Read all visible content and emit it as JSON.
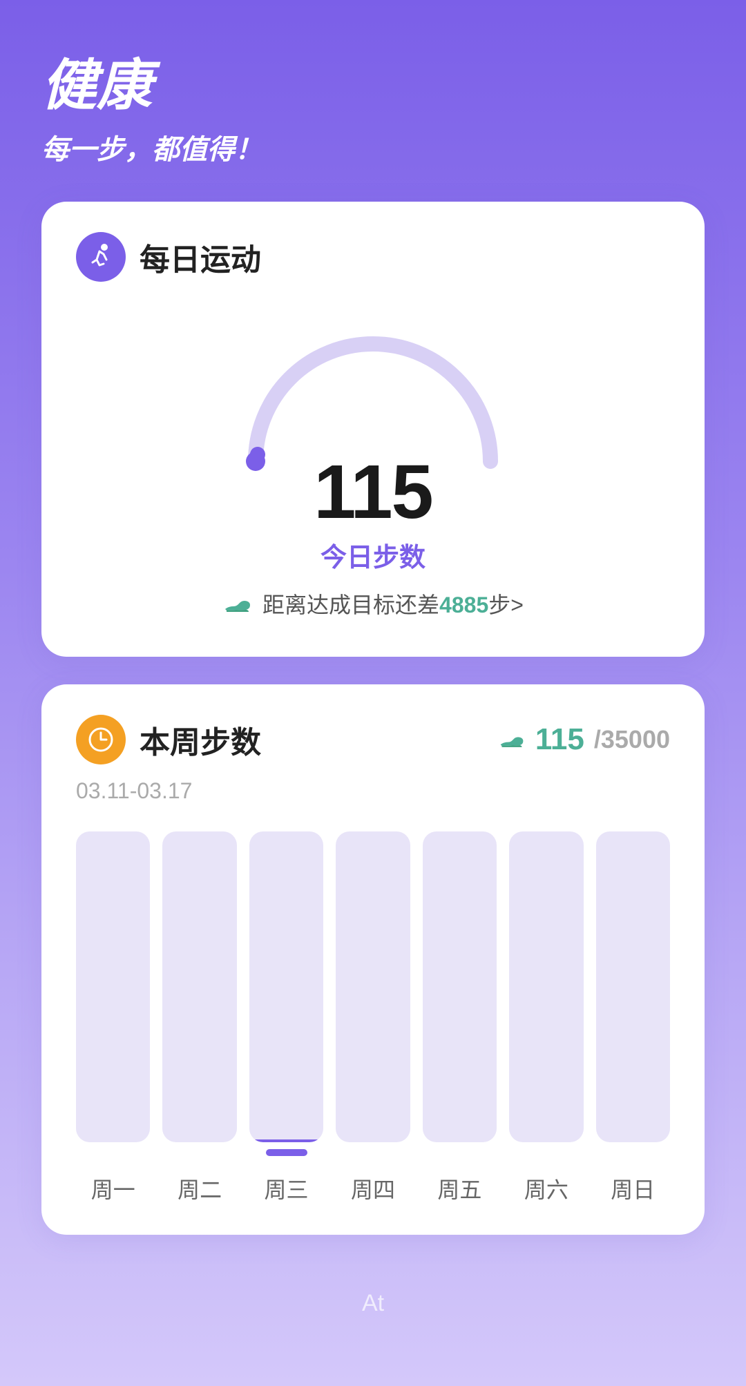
{
  "header": {
    "title": "健康",
    "subtitle": "每一步，都值得！"
  },
  "daily_card": {
    "title": "每日运动",
    "icon": "runner",
    "steps": "115",
    "steps_label": "今日步数",
    "goal_text": "距离达成目标还差",
    "goal_steps": "4885",
    "goal_unit": "步>",
    "gauge_progress": 2
  },
  "weekly_card": {
    "title": "本周步数",
    "icon": "clock",
    "current_steps": "115",
    "total_steps": "35000",
    "date_range": "03.11-03.17",
    "bars": [
      {
        "day": "周一",
        "height_pct": 0,
        "active": false
      },
      {
        "day": "周二",
        "height_pct": 0,
        "active": false
      },
      {
        "day": "周三",
        "height_pct": 1,
        "active": true
      },
      {
        "day": "周四",
        "height_pct": 0,
        "active": false
      },
      {
        "day": "周五",
        "height_pct": 0,
        "active": false
      },
      {
        "day": "周六",
        "height_pct": 0,
        "active": false
      },
      {
        "day": "周日",
        "height_pct": 0,
        "active": false
      }
    ]
  },
  "bottom_label": "At"
}
